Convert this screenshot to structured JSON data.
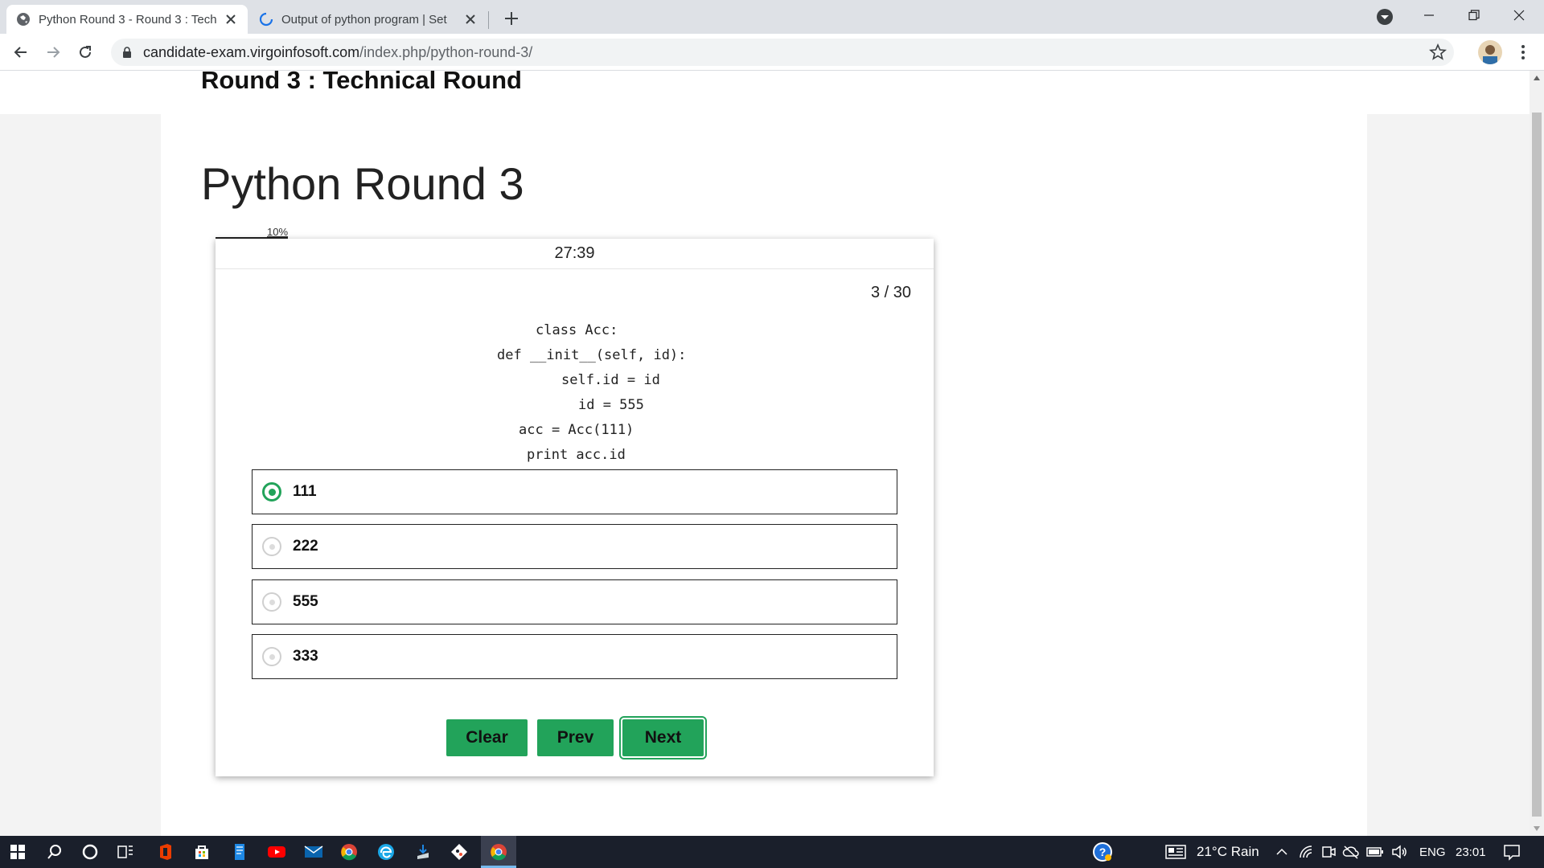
{
  "browser": {
    "tabs": [
      {
        "title": "Python Round 3 - Round 3 : Tech",
        "active": true
      },
      {
        "title": "Output of python program | Set",
        "active": false
      }
    ],
    "url_host": "candidate-exam.virgoinfosoft.com",
    "url_path": "/index.php/python-round-3/"
  },
  "page": {
    "round_heading": "Round 3 : Technical Round",
    "title": "Python Round 3"
  },
  "quiz": {
    "progress_label": "10%",
    "progress_fraction": 0.1,
    "timer": "27:39",
    "counter": "3 / 30",
    "code_lines": [
      "class Acc:",
      "def __init__(self, id):",
      "self.id = id",
      "id = 555",
      "acc = Acc(111)",
      "print acc.id"
    ],
    "options": [
      {
        "label": "111",
        "selected": true
      },
      {
        "label": "222",
        "selected": false
      },
      {
        "label": "555",
        "selected": false
      },
      {
        "label": "333",
        "selected": false
      }
    ],
    "buttons": {
      "clear": "Clear",
      "prev": "Prev",
      "next": "Next"
    }
  },
  "taskbar": {
    "weather": "21°C  Rain",
    "language": "ENG",
    "time": "23:01"
  },
  "colors": {
    "accent_green": "#22a35a",
    "taskbar_bg": "#1a1f2b",
    "tabstrip_bg": "#dee1e6"
  }
}
